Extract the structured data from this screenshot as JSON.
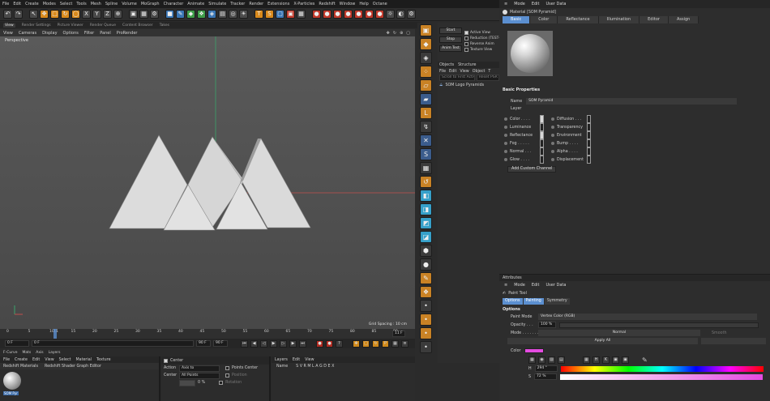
{
  "menubar": [
    "File",
    "Edit",
    "Create",
    "Modes",
    "Select",
    "Tools",
    "Mesh",
    "Spline",
    "Volume",
    "MoGraph",
    "Character",
    "Animate",
    "Simulate",
    "Tracker",
    "Render",
    "Extensions",
    "X-Particles",
    "Redshift",
    "Window",
    "Help",
    "Octane"
  ],
  "toolbar_icons": [
    "undo",
    "pointer",
    "move",
    "scale",
    "rotate",
    "live",
    "x",
    "y",
    "z",
    "world",
    "render",
    "cube",
    "pen",
    "subdiv",
    "cloner",
    "deform",
    "scene",
    "camera",
    "light",
    "t",
    "s",
    "cube2",
    "cube3",
    "sphere1",
    "sphere2",
    "sphere3",
    "sphere4",
    "sphere5",
    "sphere6",
    "sphere7",
    "gear",
    "light2"
  ],
  "editor_tabs": [
    {
      "label": "View",
      "active": true
    },
    {
      "label": "Render Settings"
    },
    {
      "label": "Picture Viewer"
    },
    {
      "label": "Render Queue"
    },
    {
      "label": "Content Browser"
    },
    {
      "label": "Takes"
    }
  ],
  "viewport_menu": [
    "View",
    "Cameras",
    "Display",
    "Options",
    "Filter",
    "Panel",
    "ProRender"
  ],
  "viewport": {
    "label": "Perspective",
    "grid_spacing": "Grid Spacing : 10 cm"
  },
  "timeline": {
    "ticks": [
      "0",
      "5",
      "10",
      "11",
      "15",
      "20",
      "25",
      "30",
      "35",
      "40",
      "45",
      "50",
      "55",
      "60",
      "65",
      "70",
      "75",
      "80",
      "85",
      "90"
    ],
    "current": "11 F"
  },
  "transport": {
    "start": "0 F",
    "cur": "0 F",
    "end": "90 F",
    "end2": "90 F"
  },
  "bottom": {
    "tabs": [
      "F-Curve",
      "Mats",
      "Axis",
      "Layers"
    ],
    "mat_menu": [
      "File",
      "Create",
      "Edit",
      "View",
      "Select",
      "Material",
      "Texture"
    ],
    "mat_tabs": [
      "Redshift Materials",
      "Redshift Shader Graph Editor"
    ],
    "swatch_label": "SOM Pyr",
    "coord": {
      "center_label": "Center",
      "action_label": "Action",
      "action_val": "Axis to",
      "center2_label": "Center",
      "center2_val": "All Points",
      "points_center": "Points Center",
      "position": "Position",
      "rotation": "Rotation",
      "y_val": "0 %"
    },
    "layers": {
      "menu": [
        "Layers",
        "Edit",
        "View"
      ],
      "name_col": "Name",
      "cols": "S V R M L A G D E X"
    }
  },
  "mid": {
    "buttons": [
      "Start",
      "Stop",
      "Anim Test"
    ],
    "checks": [
      {
        "label": "Active View",
        "on": true
      },
      {
        "label": "Reduction (TEST-C",
        "on": false
      },
      {
        "label": "Reverse Anim",
        "on": false
      },
      {
        "label": "Texture View",
        "on": false
      }
    ],
    "tabs": [
      "Objects",
      "Structure"
    ],
    "menu": [
      "File",
      "Edit",
      "View",
      "Object",
      "T"
    ],
    "fields": [
      "Scroll to First Active",
      "Reset PSR"
    ],
    "object": "SOM Logo Pyramids"
  },
  "attributes_top": {
    "menu": [
      "Mode",
      "Edit",
      "User Data"
    ],
    "material_title": "Material [SOM Pyramid]",
    "tabs": [
      {
        "label": "Basic",
        "active": true
      },
      {
        "label": "Color"
      },
      {
        "label": "Reflectance"
      },
      {
        "label": "Illumination"
      },
      {
        "label": "Editor"
      },
      {
        "label": "Assign"
      }
    ],
    "section": "Basic Properties",
    "name_label": "Name",
    "name_value": "SOM Pyramid",
    "layer_label": "Layer",
    "channels_left": [
      {
        "label": "Color . . . .",
        "on": true
      },
      {
        "label": "Luminance",
        "on": false
      },
      {
        "label": "Reflectance",
        "on": true
      },
      {
        "label": "Fog . . . . .",
        "on": false
      },
      {
        "label": "Normal . . .",
        "on": false
      },
      {
        "label": "Glow . . . .",
        "on": false
      }
    ],
    "channels_right": [
      {
        "label": "Diffusion . . .",
        "on": false
      },
      {
        "label": "Transparency",
        "on": false
      },
      {
        "label": "Environment",
        "on": false
      },
      {
        "label": "Bump . . . .",
        "on": false
      },
      {
        "label": "Alpha . . . .",
        "on": false
      },
      {
        "label": "Displacement",
        "on": false
      }
    ],
    "add_button": "Add Custom Channel"
  },
  "attributes_bottom": {
    "header": "Attributes",
    "menu": [
      "Mode",
      "Edit",
      "User Data"
    ],
    "tool_title": "Paint Tool",
    "tabs": [
      {
        "label": "Options",
        "active": true
      },
      {
        "label": "Painting",
        "active": true
      },
      {
        "label": "Symmetry"
      }
    ],
    "section": "Options",
    "paint_mode_label": "Paint Mode",
    "paint_mode_value": "Vertex Color (RGB)",
    "opacity_label": "Opacity . . .",
    "opacity_value": "100 %",
    "mode_label": "Mode . . . . . . .",
    "mode_value": "Normal",
    "smooth_label": "Smooth",
    "apply_all": "Apply All",
    "color_label": "Color",
    "color_swatch": "#e44be0",
    "h_label": "H",
    "h_value": "294 °",
    "s_label": "S",
    "s_value": "72 %"
  },
  "colors": {
    "accent": "#5b8fd0",
    "green_axis": "#3aa46a",
    "red_axis": "#c0504d"
  }
}
